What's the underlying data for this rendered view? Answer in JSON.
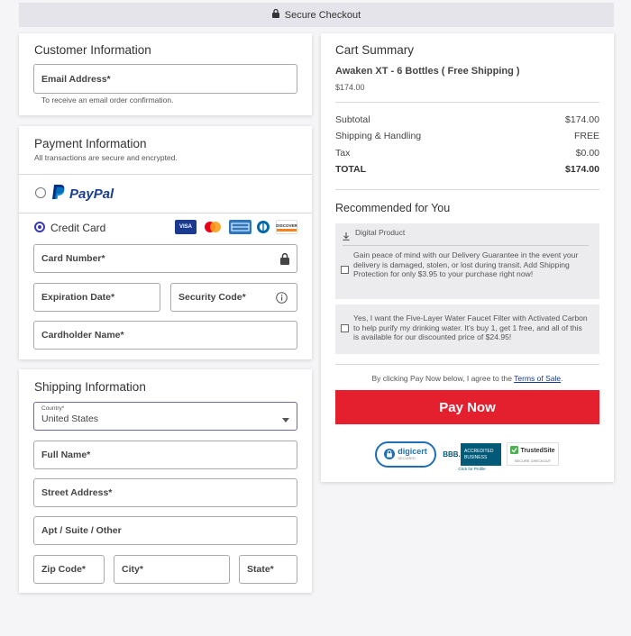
{
  "topbar": {
    "label": "Secure Checkout"
  },
  "customer": {
    "title": "Customer Information",
    "email_label": "Email Address*",
    "email_hint": "To receive an email order confirmation."
  },
  "payment": {
    "title": "Payment Information",
    "subtitle": "All transactions are secure and encrypted.",
    "paypal_label": "PayPal",
    "credit_label": "Credit Card",
    "card_number": "Card Number*",
    "expiration": "Expiration Date*",
    "security_code": "Security Code*",
    "cardholder": "Cardholder Name*",
    "cards": [
      "VISA",
      "DISCOVER"
    ]
  },
  "shipping": {
    "title": "Shipping Information",
    "country_label": "Country*",
    "country_value": "United States",
    "full_name": "Full Name*",
    "street": "Street Address*",
    "apt": "Apt / Suite / Other",
    "zip": "Zip Code*",
    "city": "City*",
    "state": "State*"
  },
  "cart": {
    "title": "Cart Summary",
    "product_name": "Awaken XT - 6 Bottles ( Free Shipping )",
    "product_price": "$174.00",
    "rows": [
      {
        "label": "Subtotal",
        "value": "$174.00"
      },
      {
        "label": "Shipping & Handling",
        "value": "FREE"
      },
      {
        "label": "Tax",
        "value": "$0.00"
      },
      {
        "label": "TOTAL",
        "value": "$174.00"
      }
    ]
  },
  "recommended": {
    "title": "Recommended for You",
    "digital_label": "Digital Product",
    "offer1": "Gain peace of mind with our Delivery Guarantee in the event your delivery is damaged, stolen, or lost during transit. Add Shipping Protection for only $3.95 to your purchase right now!",
    "offer2": "Yes, I want the Five-Layer Water Faucet Filter with Activated Carbon to help purify my drinking water. It's buy 1, get 1 free, and all of this is available for our discounted price of $24.95!"
  },
  "terms": {
    "prefix": "By clicking Pay Now below, I agree to the ",
    "link": "Terms of Sale",
    "suffix": "."
  },
  "pay_button": "Pay Now",
  "seals": {
    "digicert": "digicert",
    "digicert_sub": "SECURED",
    "bbb_line1": "ACCREDITED",
    "bbb_line2": "BUSINESS",
    "bbb_logo": "BBB.",
    "bbb_click": "Click for Profile",
    "trusted": "TrustedSite",
    "trusted_sub": "SECURE CHECKOUT"
  }
}
